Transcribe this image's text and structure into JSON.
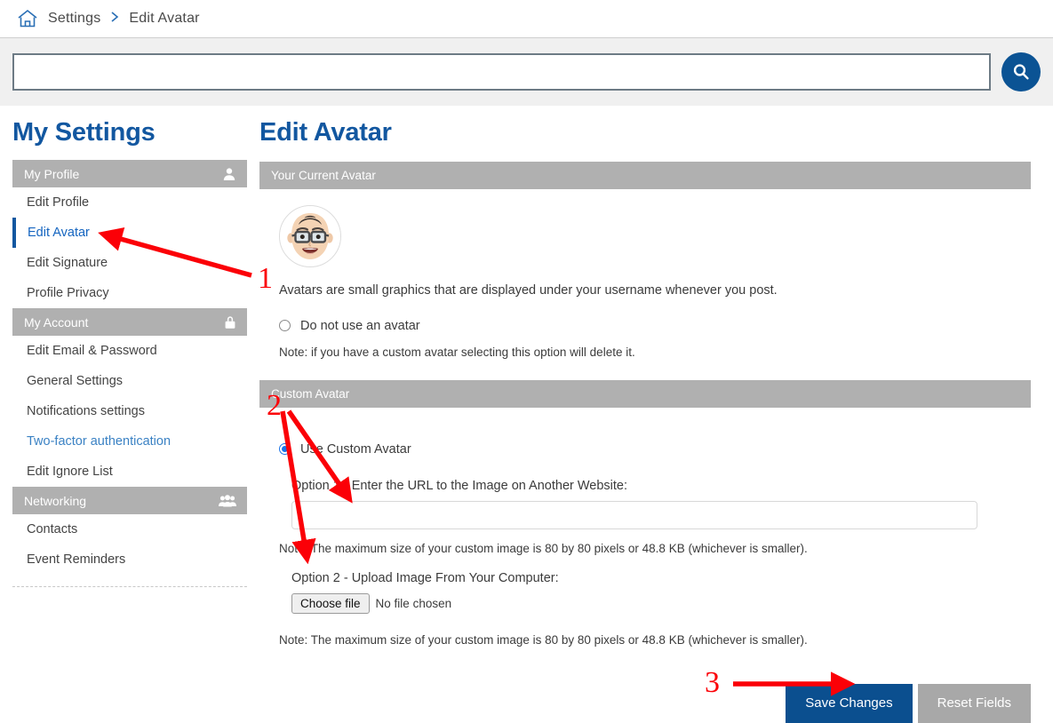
{
  "breadcrumb": {
    "home_icon": "home-icon",
    "items": [
      "Settings",
      "Edit Avatar"
    ],
    "separator": "›"
  },
  "search": {
    "value": "",
    "placeholder": "",
    "button_icon": "search-icon"
  },
  "sidebar": {
    "title": "My Settings",
    "groups": [
      {
        "label": "My Profile",
        "icon": "user-icon",
        "items": [
          {
            "label": "Edit Profile",
            "state": "normal"
          },
          {
            "label": "Edit Avatar",
            "state": "active"
          },
          {
            "label": "Edit Signature",
            "state": "normal"
          },
          {
            "label": "Profile Privacy",
            "state": "normal"
          }
        ]
      },
      {
        "label": "My Account",
        "icon": "lock-icon",
        "items": [
          {
            "label": "Edit Email & Password",
            "state": "normal"
          },
          {
            "label": "General Settings",
            "state": "normal"
          },
          {
            "label": "Notifications settings",
            "state": "normal"
          },
          {
            "label": "Two-factor authentication",
            "state": "link"
          },
          {
            "label": "Edit Ignore List",
            "state": "normal"
          }
        ]
      },
      {
        "label": "Networking",
        "icon": "people-icon",
        "items": [
          {
            "label": "Contacts",
            "state": "normal"
          },
          {
            "label": "Event Reminders",
            "state": "normal"
          }
        ]
      }
    ]
  },
  "main": {
    "title": "Edit Avatar",
    "current_avatar": {
      "header": "Your Current Avatar",
      "avatar_icon": "memoji-avatar",
      "description": "Avatars are small graphics that are displayed under your username whenever you post.",
      "no_avatar_option": "Do not use an avatar",
      "no_avatar_checked": false,
      "no_avatar_note": "Note: if you have a custom avatar selecting this option will delete it."
    },
    "custom_avatar": {
      "header": "Custom Avatar",
      "use_custom_option": "Use Custom Avatar",
      "use_custom_checked": true,
      "option1_label": "Option 1 - Enter the URL to the Image on Another Website:",
      "url_value": "",
      "url_placeholder": "",
      "option1_note": "Note: The maximum size of your custom image is 80 by 80 pixels or 48.8 KB (whichever is smaller).",
      "option2_label": "Option 2 - Upload Image From Your Computer:",
      "choose_file_label": "Choose file",
      "file_status": "No file chosen",
      "option2_note": "Note: The maximum size of your custom image is 80 by 80 pixels or 48.8 KB (whichever is smaller)."
    },
    "buttons": {
      "save_label": "Save Changes",
      "reset_label": "Reset Fields"
    }
  },
  "annotations": {
    "color": "#fb0007",
    "markers": [
      {
        "number": "1",
        "target": "sidebar-item-edit-avatar"
      },
      {
        "number": "2",
        "target": "custom-avatar-url-and-upload"
      },
      {
        "number": "3",
        "target": "save-changes-button"
      }
    ]
  },
  "colors": {
    "brand_blue": "#1257a0",
    "button_blue": "#0b4f8f",
    "header_gray": "#b0b0b0",
    "secondary_gray": "#a8a8a8",
    "search_bg": "#f0f0f0",
    "annotation_red": "#fb0007"
  }
}
